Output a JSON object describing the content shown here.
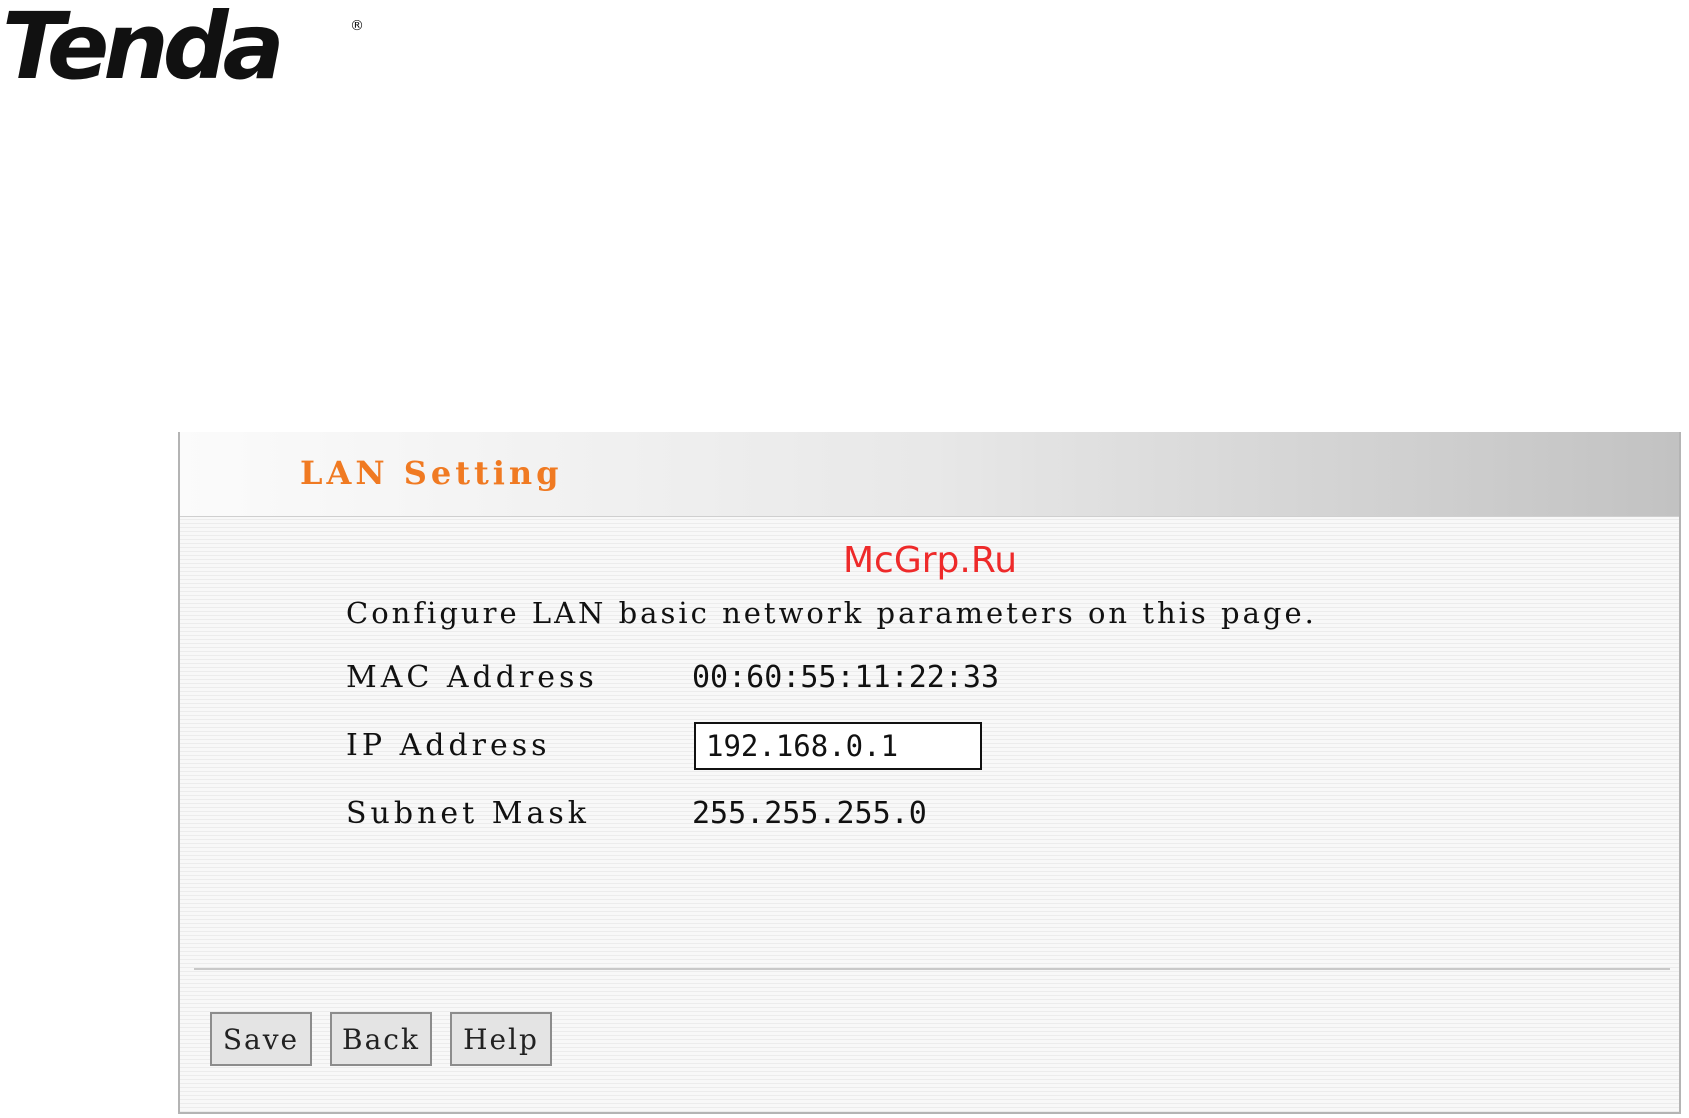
{
  "logo": {
    "text": "Tenda",
    "registered_mark": "®"
  },
  "watermark": "McGrp.Ru",
  "panel": {
    "title": "LAN Setting",
    "title_color": "#f07a22",
    "description": "Configure LAN basic network parameters on this page.",
    "fields": {
      "mac": {
        "label": "MAC Address",
        "value": "00:60:55:11:22:33"
      },
      "ip": {
        "label": "IP Address",
        "value": "192.168.0.1"
      },
      "mask": {
        "label": "Subnet Mask",
        "value": "255.255.255.0"
      }
    },
    "buttons": {
      "save": "Save",
      "back": "Back",
      "help": "Help"
    }
  }
}
